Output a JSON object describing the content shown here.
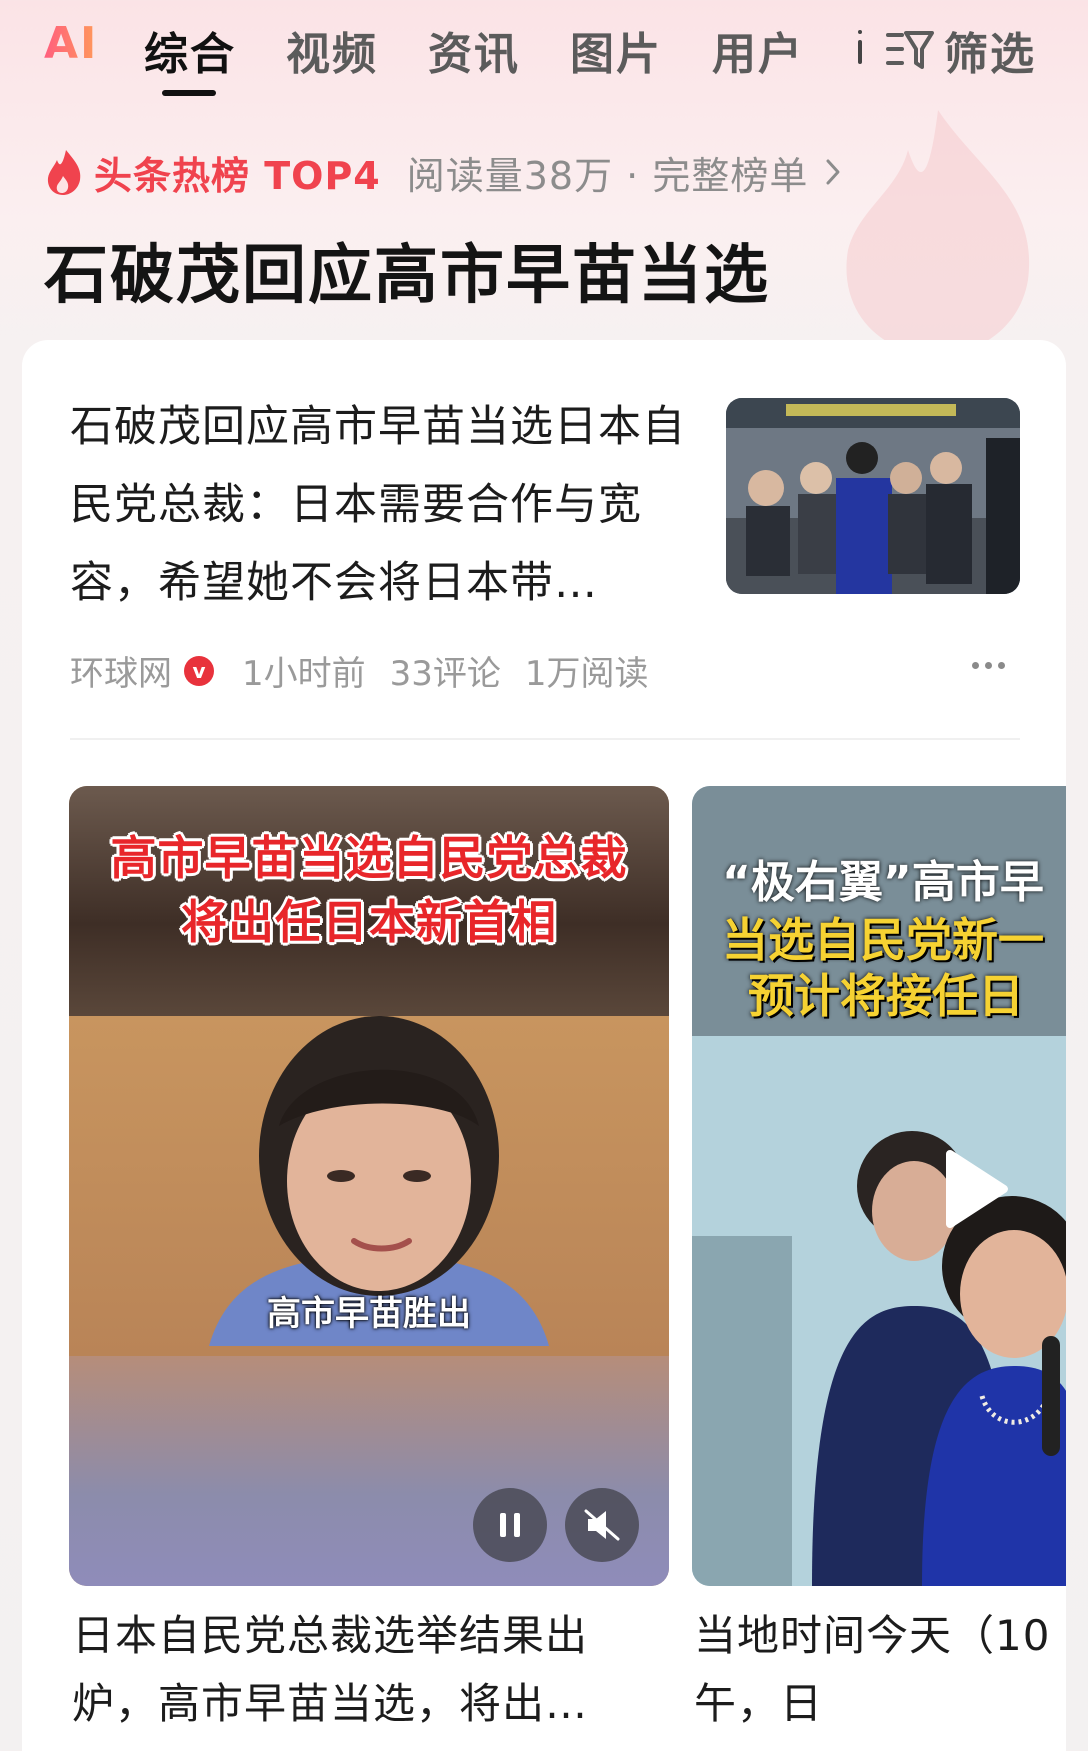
{
  "tabs": {
    "ai": "AI",
    "items": [
      "综合",
      "视频",
      "资讯",
      "图片",
      "用户"
    ],
    "filter": "筛选"
  },
  "hot": {
    "label": "头条热榜 TOP4",
    "meta": "阅读量38万 · 完整榜单",
    "topic": "石破茂回应高市早苗当选"
  },
  "article": {
    "title": "石破茂回应高市早苗当选日本自民党总裁：日本需要合作与宽容，希望她不会将日本带…",
    "source": "环球网",
    "verified": "v",
    "time": "1小时前",
    "comments": "33评论",
    "reads": "1万阅读"
  },
  "videos": [
    {
      "overlay_line1": "高市早苗当选自民党总裁",
      "overlay_line2": "将出任日本新首相",
      "caption": "高市早苗胜出",
      "title": "日本自民党总裁选举结果出炉，高市早苗当选，将出…"
    },
    {
      "overlay_line1": "“极右翼”高市早",
      "overlay_line2": "当选自民党新一",
      "overlay_line3": "预计将接任日",
      "title_line1": "当地时间今天（10",
      "title_line2": "午，日"
    }
  ],
  "colors": {
    "hot_red": "#f0434e",
    "overlay_red": "#e8262a",
    "overlay_yellow": "#f6d232"
  }
}
